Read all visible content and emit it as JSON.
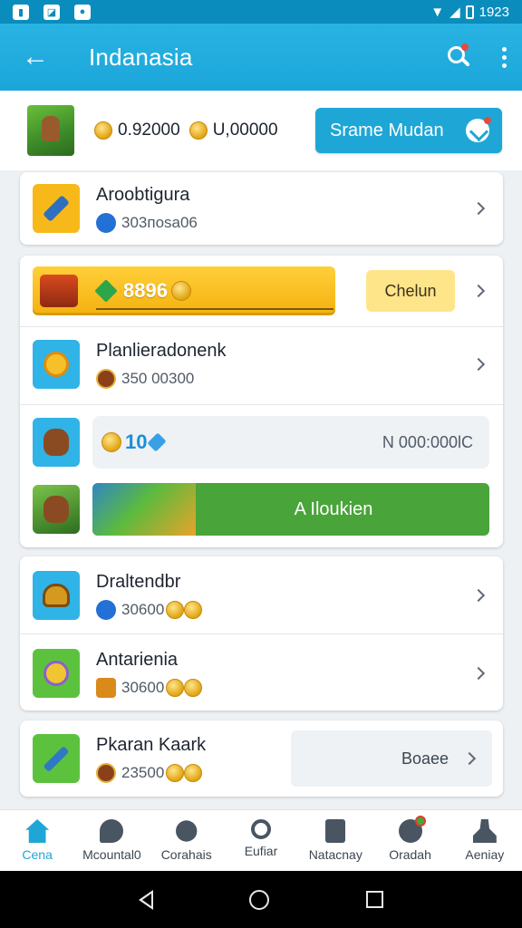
{
  "status_bar": {
    "time": "1923"
  },
  "app_bar": {
    "title": "Indanasia"
  },
  "header": {
    "currency_1": "0.92000",
    "currency_2": "U,00000",
    "share_label": "Srame Mudan"
  },
  "cards": {
    "item_1": {
      "title": "Aroobtigura",
      "sub": "303поsа06"
    },
    "bonus": {
      "value": "8896",
      "claim_label": "Chelun"
    },
    "item_2": {
      "title": "Planlieradonenk",
      "sub": "350 00300"
    },
    "quest": {
      "value": "10",
      "right_text": "N 000:000ƖC"
    },
    "play": {
      "label": "A Iloukien"
    },
    "item_3": {
      "title": "Draltendbr",
      "sub": "30600"
    },
    "item_4": {
      "title": "Antarienia",
      "sub": "30600"
    },
    "item_5": {
      "title": "Pkaran Kaark",
      "sub": "23500",
      "boost_label": "Boaee"
    }
  },
  "bottom_nav": [
    {
      "label": "Cena",
      "icon": "home-icon",
      "active": true
    },
    {
      "label": "Mcountal0",
      "icon": "chat-icon"
    },
    {
      "label": "Corahais",
      "icon": "people-icon"
    },
    {
      "label": "Eufiar",
      "icon": "search-icon"
    },
    {
      "label": "Natacnay",
      "icon": "document-icon"
    },
    {
      "label": "Oradah",
      "icon": "messages-icon"
    },
    {
      "label": "Aeniay",
      "icon": "profile-icon"
    }
  ],
  "colors": {
    "accent": "#1ea7d6",
    "app_bar": "#29b3e3",
    "bonus": "#f4b10e",
    "play": "#49a43a"
  }
}
